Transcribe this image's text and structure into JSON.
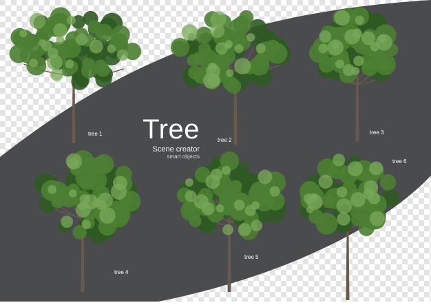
{
  "title": {
    "main": "Tree",
    "subtitle": "Scene creator",
    "tagline": "smart objects"
  },
  "trees": [
    {
      "label": "tree 1"
    },
    {
      "label": "tree 2"
    },
    {
      "label": "tree 3"
    },
    {
      "label": "tree 4"
    },
    {
      "label": "tree 5"
    },
    {
      "label": "tree 6"
    }
  ],
  "colors": {
    "band": "#4a4b4d",
    "checker_light": "#ffffff",
    "checker_dark": "#e3e3e3",
    "foliage_dark": "#2f5a22",
    "foliage_mid": "#4d7f33",
    "foliage_light": "#7aa85a",
    "trunk": "#6a5a4e"
  }
}
